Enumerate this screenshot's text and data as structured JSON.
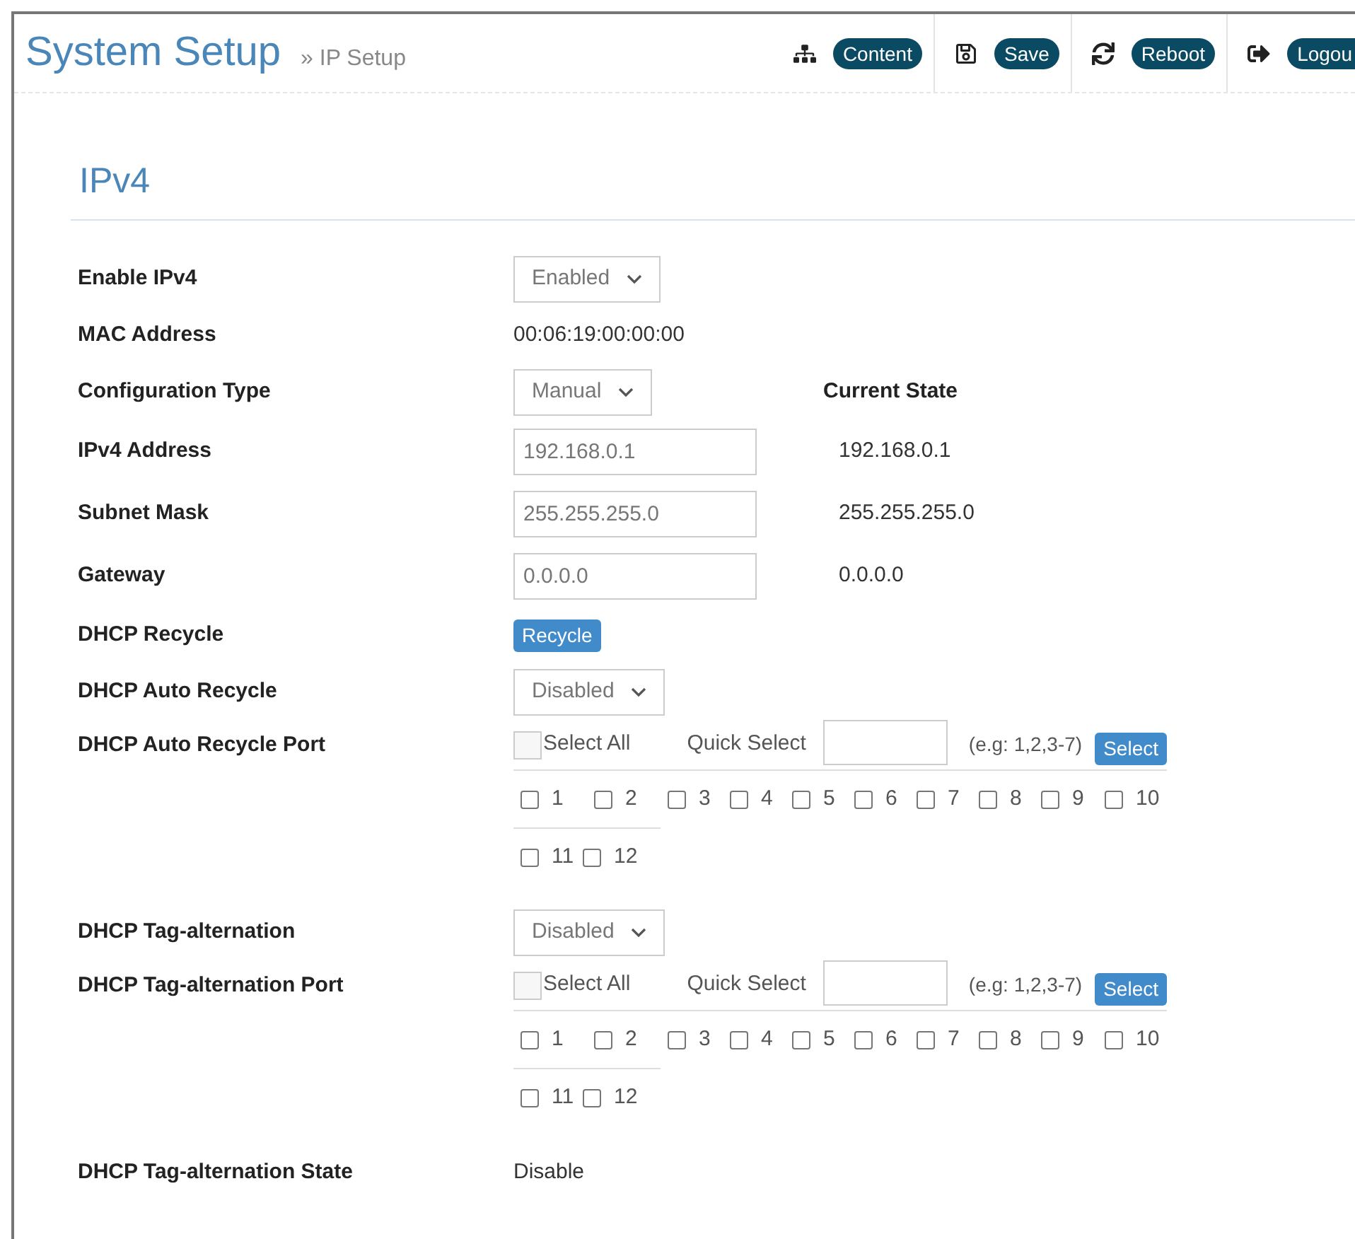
{
  "header": {
    "title": "System Setup",
    "breadcrumb": "» IP Setup",
    "actions": [
      {
        "kind": "sitemap",
        "label": "Content"
      },
      {
        "kind": "save",
        "label": "Save"
      },
      {
        "kind": "reload",
        "label": "Reboot"
      },
      {
        "kind": "logout",
        "label": "Logou"
      }
    ]
  },
  "section": {
    "title": "IPv4"
  },
  "rows": [
    {
      "kind": "select",
      "label": "Enable IPv4",
      "value": "Enabled"
    },
    {
      "kind": "text",
      "label": "MAC Address",
      "value": "00:06:19:00:00:00"
    },
    {
      "kind": "select",
      "label": "Configuration Type",
      "value": "Manual",
      "state_heading": "Current State"
    },
    {
      "kind": "input",
      "label": "IPv4 Address",
      "value": "192.168.0.1",
      "state": "192.168.0.1"
    },
    {
      "kind": "input",
      "label": "Subnet Mask",
      "value": "255.255.255.0",
      "state": "255.255.255.0"
    },
    {
      "kind": "input",
      "label": "Gateway",
      "value": "0.0.0.0",
      "state": "0.0.0.0"
    },
    {
      "kind": "button",
      "label": "DHCP Recycle",
      "button": "Recycle"
    },
    {
      "kind": "select",
      "label": "DHCP Auto Recycle",
      "value": "Disabled"
    },
    {
      "kind": "ports",
      "label": "DHCP Auto Recycle Port",
      "select_all": {
        "label": "Select All",
        "checked": false
      },
      "quick_select": {
        "label": "Quick Select",
        "hint": "(e.g: 1,2,3-7)",
        "button": "Select"
      },
      "ports": [
        {
          "label": "1",
          "checked": false
        },
        {
          "label": "2",
          "checked": false
        },
        {
          "label": "3",
          "checked": false
        },
        {
          "label": "4",
          "checked": false
        },
        {
          "label": "5",
          "checked": false
        },
        {
          "label": "6",
          "checked": false
        },
        {
          "label": "7",
          "checked": false
        },
        {
          "label": "8",
          "checked": false
        },
        {
          "label": "9",
          "checked": false
        },
        {
          "label": "10",
          "checked": false
        },
        {
          "label": "11",
          "checked": false
        },
        {
          "label": "12",
          "checked": false
        }
      ]
    },
    {
      "kind": "select",
      "label": "DHCP Tag-alternation",
      "value": "Disabled"
    },
    {
      "kind": "ports",
      "label": "DHCP Tag-alternation Port",
      "select_all": {
        "label": "Select All",
        "checked": false
      },
      "quick_select": {
        "label": "Quick Select",
        "hint": "(e.g: 1,2,3-7)",
        "button": "Select"
      },
      "ports": [
        {
          "label": "1",
          "checked": false
        },
        {
          "label": "2",
          "checked": false
        },
        {
          "label": "3",
          "checked": false
        },
        {
          "label": "4",
          "checked": false
        },
        {
          "label": "5",
          "checked": false
        },
        {
          "label": "6",
          "checked": false
        },
        {
          "label": "7",
          "checked": false
        },
        {
          "label": "8",
          "checked": false
        },
        {
          "label": "9",
          "checked": false
        },
        {
          "label": "10",
          "checked": false
        },
        {
          "label": "11",
          "checked": false
        },
        {
          "label": "12",
          "checked": false
        }
      ]
    },
    {
      "kind": "text",
      "label": "DHCP Tag-alternation State",
      "value": "Disable"
    }
  ]
}
